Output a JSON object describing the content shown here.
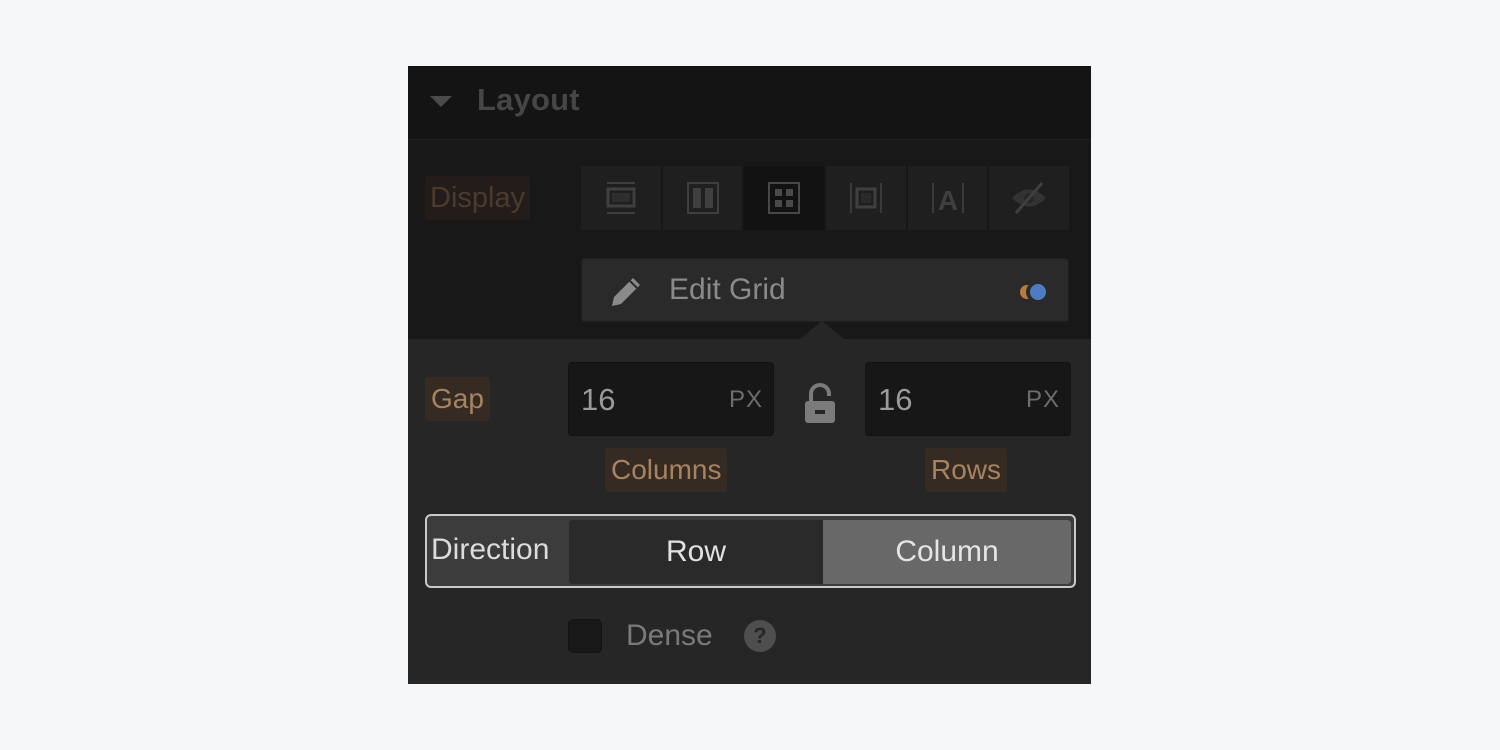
{
  "section": {
    "title": "Layout",
    "collapse_icon": "caret-down-icon"
  },
  "display": {
    "label": "Display",
    "options": [
      {
        "name": "block",
        "icon": "display-block-icon",
        "active": false
      },
      {
        "name": "flex",
        "icon": "display-flex-icon",
        "active": false
      },
      {
        "name": "grid",
        "icon": "display-grid-icon",
        "active": true
      },
      {
        "name": "inline-block",
        "icon": "display-inline-block-icon",
        "active": false
      },
      {
        "name": "inline",
        "icon": "display-inline-icon",
        "active": false
      },
      {
        "name": "none",
        "icon": "display-none-icon",
        "active": false
      }
    ]
  },
  "edit_grid": {
    "label": "Edit Grid",
    "icon": "pencil-icon",
    "indicator_colors": [
      "#b97a3c",
      "#4d7cc4"
    ]
  },
  "gap": {
    "label": "Gap",
    "columns": {
      "value": "16",
      "unit": "PX",
      "label": "Columns"
    },
    "rows": {
      "value": "16",
      "unit": "PX",
      "label": "Rows"
    },
    "lock_icon": "unlock-icon"
  },
  "direction": {
    "label": "Direction",
    "options": [
      "Row",
      "Column"
    ],
    "selected": "Column"
  },
  "dense": {
    "label": "Dense",
    "checked": false,
    "help": "?"
  },
  "colors": {
    "accent_label": "#a7835f",
    "indicator_orange": "#b97a3c",
    "indicator_blue": "#4d7cc4"
  }
}
